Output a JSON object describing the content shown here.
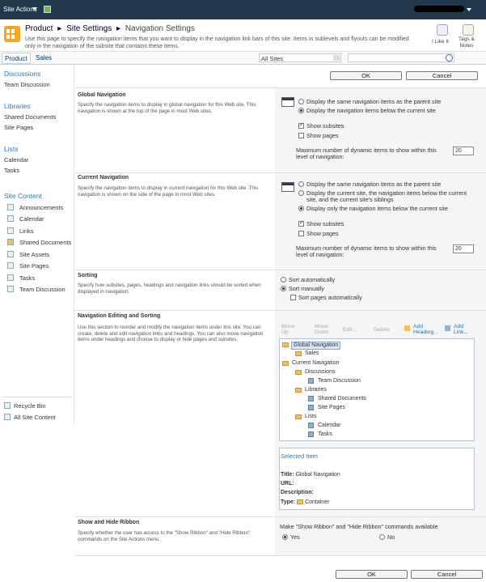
{
  "topbar": {
    "site_actions": "Site Actions"
  },
  "breadcrumb": {
    "site": "Product",
    "settings": "Site Settings",
    "current": "Navigation Settings",
    "sep": "▸"
  },
  "description": "Use this page to specify the navigation items that you want to display in the navigation link bars of this site. Items in sublevels and flyouts can be modified only in the navigation of the subsite that contains these items.",
  "social": {
    "like": "I Like It",
    "tags": "Tags &",
    "notes": "Notes"
  },
  "topnav": {
    "product": "Product",
    "sales": "Sales"
  },
  "search": {
    "scope": "All Sites",
    "value": ""
  },
  "leftnav": {
    "discussions": "Discussions",
    "team_discussion": "Team Discussion",
    "libraries": "Libraries",
    "shared_documents": "Shared Documents",
    "site_pages": "Site Pages",
    "lists": "Lists",
    "calendar": "Calendar",
    "tasks": "Tasks",
    "site_content": "Site Content",
    "content_items": [
      "Announcements",
      "Calendar",
      "Links",
      "Shared Documents",
      "Site Assets",
      "Site Pages",
      "Tasks",
      "Team Discussion"
    ],
    "recycle_bin": "Recycle Bin",
    "all_site_content": "All Site Content"
  },
  "buttons": {
    "ok": "OK",
    "cancel": "Cancel"
  },
  "global_nav": {
    "title": "Global Navigation",
    "desc": "Specify the navigation items to display in global navigation for this Web site. This navigation is shown at the top of the page in most Web sites.",
    "opt_parent": "Display the same navigation items as the parent site",
    "opt_below": "Display the navigation items below the current site",
    "show_subsites": "Show subsites",
    "show_pages": "Show pages",
    "max_label": "Maximum number of dynamic items to show within this level of navigation:",
    "max_value": "20"
  },
  "current_nav": {
    "title": "Current Navigation",
    "desc": "Specify the navigation items to display in current navigation for this Web site. This navigation is shown on the side of the page in most Web sites.",
    "opt_parent": "Display the same navigation items as the parent site",
    "opt_siblings": "Display the current site, the navigation items below the current site, and the current site's siblings",
    "opt_only_below": "Display only the navigation items below the current site",
    "show_subsites": "Show subsites",
    "show_pages": "Show pages",
    "max_label": "Maximum number of dynamic items to show within this level of navigation:",
    "max_value": "20"
  },
  "sorting": {
    "title": "Sorting",
    "desc": "Specify how subsites, pages, headings and navigation links should be sorted when displayed in navigation.",
    "auto": "Sort automatically",
    "manual": "Sort manually",
    "pages_auto": "Sort pages automatically"
  },
  "editing": {
    "title": "Navigation Editing and Sorting",
    "desc": "Use this section to reorder and modify the navigation items under this site. You can create, delete and edit navigation links and headings. You can also move navigation items under headings and choose to display or hide pages and subsites.",
    "tools": {
      "move_up": "Move Up",
      "move_down": "Move Down",
      "edit": "Edit...",
      "delete": "Delete",
      "add_heading": "Add Heading...",
      "add_link": "Add Link..."
    },
    "tree": {
      "global": "Global Navigation",
      "sales": "Sales",
      "current": "Current Navigation",
      "discussions": "Discussions",
      "team_discussion": "Team Discussion",
      "libraries": "Libraries",
      "shared_documents": "Shared Documents",
      "site_pages": "Site Pages",
      "lists": "Lists",
      "calendar": "Calendar",
      "tasks": "Tasks"
    },
    "selected": {
      "heading": "Selected Item",
      "title_label": "Title:",
      "title_value": "Global Navigation",
      "url_label": "URL:",
      "desc_label": "Description:",
      "type_label": "Type:",
      "type_value": "Container"
    }
  },
  "ribbon": {
    "title": "Show and Hide Ribbon",
    "desc": "Specify whether the user has access to the \"Show Ribbon\" and \"Hide Ribbon\" commands on the Site Actions menu.",
    "question": "Make \"Show Ribbon\" and \"Hide Ribbon\" commands available",
    "yes": "Yes",
    "no": "No"
  }
}
